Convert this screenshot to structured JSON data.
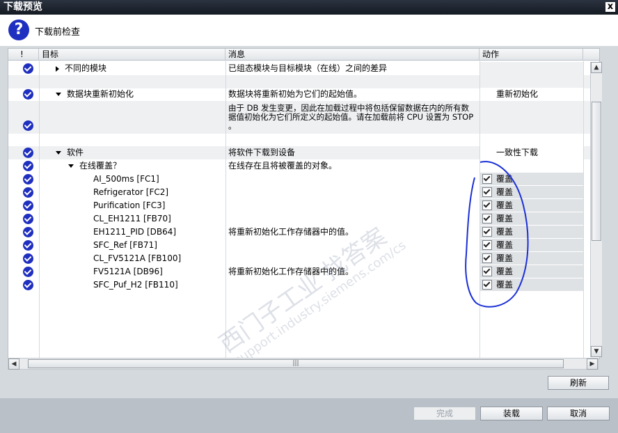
{
  "window": {
    "title": "下载预览",
    "close": "x"
  },
  "header": {
    "label": "下载前检查"
  },
  "columns": {
    "status": "!",
    "target": "目标",
    "message": "消息",
    "action": "动作"
  },
  "rows": {
    "r0": {
      "target": "不同的模块",
      "message": "已组态模块与目标模块（在线）之间的差异"
    },
    "r1": {
      "target": "数据块重新初始化",
      "message": "数据块将重新初始为它们的起始值。",
      "action": "重新初始化"
    },
    "r2": {
      "message_l1": "由于 DB 发生变更，因此在加载过程中将包括保留数据在内的所有数",
      "message_l2": "据值初始化为它们所定义的起始值。请在加载前将 CPU 设置为 STOP",
      "message_l3": "。"
    },
    "r3": {
      "target": "软件",
      "message": "将软件下载到设备",
      "action": "一致性下载"
    },
    "r4": {
      "target": "在线覆盖？",
      "message": "在线存在且将被覆盖的对象。"
    },
    "r5": {
      "target": "AI_500ms [FC1]",
      "action": "覆盖"
    },
    "r6": {
      "target": "Refrigerator [FC2]",
      "action": "覆盖"
    },
    "r7": {
      "target": "Purification [FC3]",
      "action": "覆盖"
    },
    "r8": {
      "target": "CL_EH1211 [FB70]",
      "action": "覆盖"
    },
    "r9": {
      "target": "EH1211_PID [DB64]",
      "message": "将重新初始化工作存储器中的值。",
      "action": "覆盖"
    },
    "r10": {
      "target": "SFC_Ref [FB71]",
      "action": "覆盖"
    },
    "r11": {
      "target": "CL_FV5121A [FB100]",
      "action": "覆盖"
    },
    "r12": {
      "target": "FV5121A [DB96]",
      "message": "将重新初始化工作存储器中的值。",
      "action": "覆盖"
    },
    "r13": {
      "target": "SFC_Puf_H2 [FB110]",
      "action": "覆盖"
    }
  },
  "buttons": {
    "refresh": "刷新",
    "finish": "完成",
    "load": "装载",
    "cancel": "取消"
  },
  "watermark": {
    "line1": "西门子工业   找答案",
    "line2": "support.industry.siemens.com/cs"
  },
  "colors": {
    "check": "#1f2fbf",
    "annotation": "#1a2fd6"
  }
}
